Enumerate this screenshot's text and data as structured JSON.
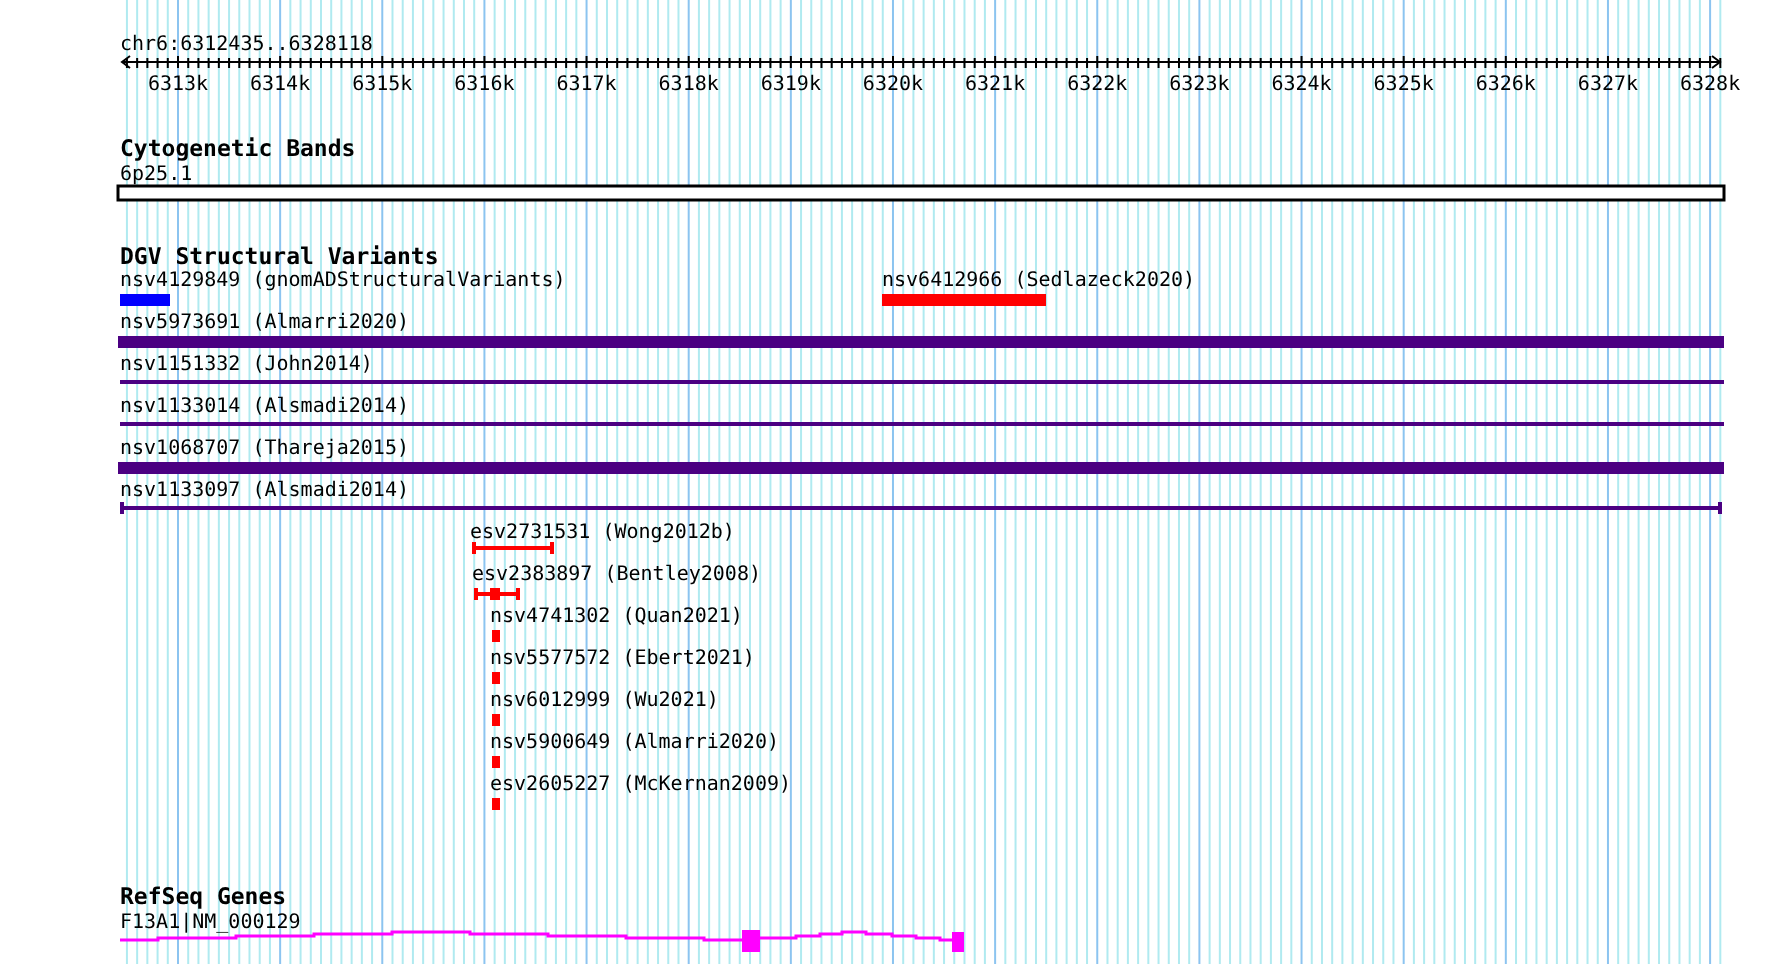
{
  "region": "chr6:6312435..6328118",
  "ruler": {
    "ticks": [
      "6313k",
      "6314k",
      "6315k",
      "6316k",
      "6317k",
      "6318k",
      "6319k",
      "6320k",
      "6321k",
      "6322k",
      "6323k",
      "6324k",
      "6325k",
      "6326k",
      "6327k",
      "6328k"
    ]
  },
  "tracks": [
    {
      "title": "Cytogenetic Bands",
      "features": [
        {
          "label": "6p25.1",
          "kind": "band",
          "color": "#ffffff"
        }
      ]
    },
    {
      "title": "DGV Structural Variants",
      "features": [
        {
          "label": "nsv4129849 (gnomADStructuralVariants)",
          "kind": "thick",
          "color": "#0000ff"
        },
        {
          "label": "nsv6412966 (Sedlazeck2020)",
          "kind": "thick",
          "color": "#ff0000"
        },
        {
          "label": "nsv5973691 (Almarri2020)",
          "kind": "thick",
          "color": "#4b0082"
        },
        {
          "label": "nsv1151332 (John2014)",
          "kind": "thin",
          "color": "#4b0082"
        },
        {
          "label": "nsv1133014 (Alsmadi2014)",
          "kind": "thin",
          "color": "#4b0082"
        },
        {
          "label": "nsv1068707 (Thareja2015)",
          "kind": "thick",
          "color": "#4b0082"
        },
        {
          "label": "nsv1133097 (Alsmadi2014)",
          "kind": "capped",
          "color": "#4b0082"
        },
        {
          "label": "esv2731531 (Wong2012b)",
          "kind": "capped",
          "color": "#ff0000"
        },
        {
          "label": "esv2383897 (Bentley2008)",
          "kind": "capped-block",
          "color": "#ff0000"
        },
        {
          "label": "nsv4741302 (Quan2021)",
          "kind": "block",
          "color": "#ff0000"
        },
        {
          "label": "nsv5577572 (Ebert2021)",
          "kind": "block",
          "color": "#ff0000"
        },
        {
          "label": "nsv6012999 (Wu2021)",
          "kind": "block",
          "color": "#ff0000"
        },
        {
          "label": "nsv5900649 (Almarri2020)",
          "kind": "block",
          "color": "#ff0000"
        },
        {
          "label": "esv2605227 (McKernan2009)",
          "kind": "block",
          "color": "#ff0000"
        }
      ]
    },
    {
      "title": "RefSeq Genes",
      "features": [
        {
          "label": "F13A1|NM_000129",
          "kind": "gene",
          "color": "#ff00ff"
        }
      ]
    }
  ]
}
